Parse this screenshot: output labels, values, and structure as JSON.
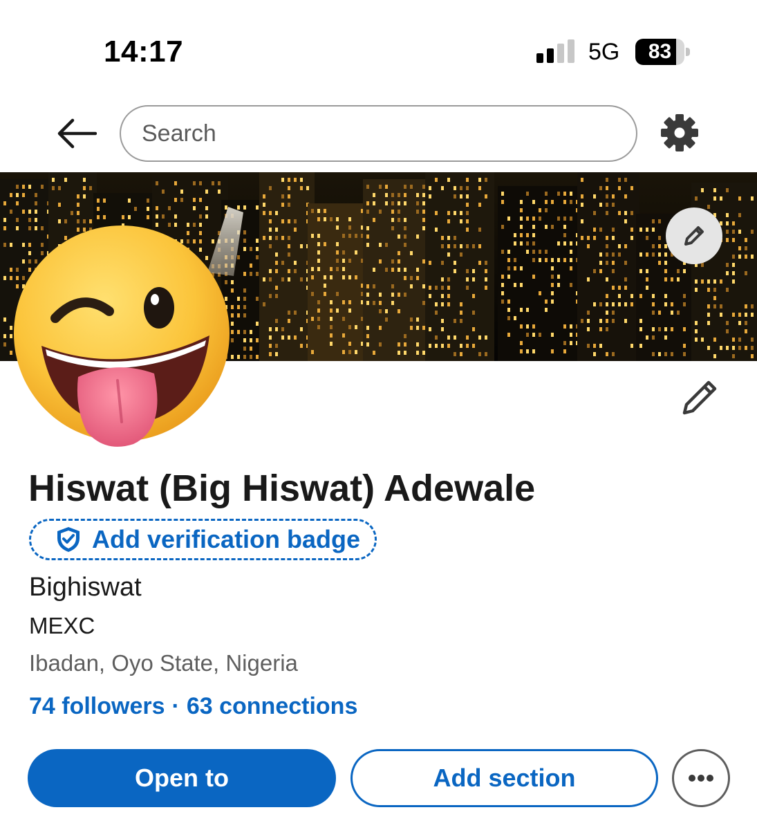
{
  "status_bar": {
    "time": "14:17",
    "network": "5G",
    "battery": "83",
    "battery_level": 0.83,
    "signal_icon": "cellular-signal-icon"
  },
  "nav": {
    "back_icon": "arrow-left-icon",
    "search_placeholder": "Search",
    "settings_icon": "gear-icon"
  },
  "banner": {
    "image": "night-city-skyline",
    "edit_icon": "pencil-icon"
  },
  "profile": {
    "avatar": "winking-face-with-tongue-emoji",
    "edit_icon": "pencil-icon",
    "name": "Hiswat (Big Hiswat) Adewale",
    "verification": {
      "label": "Add verification badge",
      "icon": "shield-check-icon"
    },
    "headline": "Bighiswat",
    "company": "MEXC",
    "location": "Ibadan, Oyo State, Nigeria",
    "followers": "74 followers",
    "separator": "·",
    "connections": "63 connections"
  },
  "actions": {
    "open_to": "Open to",
    "add_section": "Add section",
    "more_icon": "ellipsis-icon"
  },
  "colors": {
    "accent": "#0a66c2",
    "text": "#191919",
    "muted": "#5e5e5e"
  }
}
